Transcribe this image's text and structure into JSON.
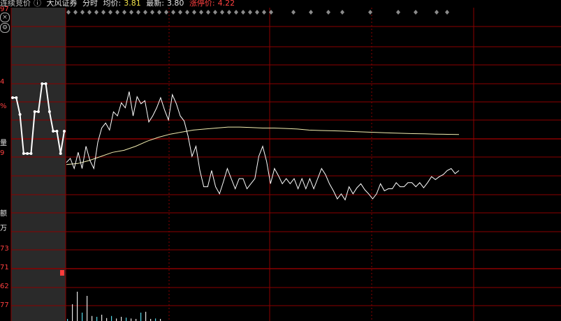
{
  "header": {
    "mode_label": "连续竞价",
    "info_icon": "info-icon",
    "stock_name": "大风证券",
    "view_label": "分时",
    "avg_label": "均价:",
    "avg_value": "3.81",
    "latest_label": "最新:",
    "latest_value": "3.80",
    "limit_label": "涨停价:",
    "limit_value": "4.22"
  },
  "left_axis": {
    "top_value": "97",
    "label_1": "4",
    "label_2": "%",
    "label_3": "量",
    "label_4": "9",
    "label_5": "额",
    "label_6": "万",
    "label_7": "73",
    "label_8": "71",
    "label_9": "62",
    "label_10": "77"
  },
  "left_icons": [
    "close-icon",
    "settings-icon"
  ],
  "colors": {
    "background": "#000000",
    "grid": "#8b0000",
    "price_line": "#ffffff",
    "avg_line": "#f2edb0",
    "auction_panel": "#2a2a2a",
    "volume_cyan": "#55d7e8",
    "volume_red": "#ff3b3b"
  },
  "chart_data": {
    "type": "line",
    "series": [
      {
        "values": [
          0.16,
          0.2,
          0.1,
          0.26,
          0.1,
          0.32,
          0.18,
          0.1,
          0.36,
          0.5,
          0.55,
          0.48,
          0.66,
          0.62,
          0.75,
          0.7,
          0.86,
          0.62,
          0.81,
          0.74,
          0.77,
          0.56,
          0.62,
          0.7,
          0.8,
          0.68,
          0.58,
          0.83,
          0.74,
          0.62,
          0.57,
          0.42,
          0.22,
          0.32,
          0.08,
          -0.08,
          -0.08,
          0.08,
          -0.08,
          -0.15,
          -0.03,
          0.1,
          0.0,
          -0.1,
          0.0,
          0.0,
          -0.1,
          -0.05,
          0.0,
          0.22,
          0.32,
          0.17,
          -0.05,
          0.1,
          0.03,
          -0.05,
          0.0,
          -0.05,
          0.0,
          -0.1,
          0.0,
          -0.1,
          0.0,
          -0.1,
          0.0,
          0.1,
          0.04,
          -0.05,
          -0.12,
          -0.2,
          -0.15,
          -0.21,
          -0.08,
          -0.15,
          -0.09,
          -0.05,
          -0.11,
          -0.15,
          -0.2,
          -0.15,
          -0.05,
          -0.12,
          -0.1,
          -0.1,
          -0.04,
          -0.08,
          -0.08,
          -0.04,
          -0.04,
          -0.08,
          -0.04,
          -0.09,
          -0.04,
          0.02,
          -0.01,
          0.02,
          0.04,
          0.08,
          0.1,
          0.05,
          0.08
        ]
      },
      {
        "values": [
          0.14,
          0.15,
          0.18,
          0.22,
          0.26,
          0.28,
          0.32,
          0.37,
          0.41,
          0.44,
          0.46,
          0.48,
          0.49,
          0.5,
          0.51,
          0.51,
          0.505,
          0.5,
          0.5,
          0.496,
          0.49,
          0.48,
          0.476,
          0.473,
          0.47,
          0.465,
          0.46,
          0.456,
          0.452,
          0.448,
          0.445,
          0.443,
          0.44,
          0.438,
          0.436
        ]
      }
    ],
    "grid": true
  },
  "volume": {
    "values": [
      0.05,
      0.4,
      0.7,
      0.2,
      0.6,
      0.12,
      0.1,
      0.15,
      0.07,
      0.12,
      0.06,
      0.1,
      0.08,
      0.06,
      0.05,
      0.2,
      0.22,
      0.05,
      0.06,
      0.05
    ]
  },
  "auction_trace": {
    "values": [
      0.8,
      0.8,
      0.74,
      0.6,
      0.6,
      0.6,
      0.75,
      0.75,
      0.85,
      0.85,
      0.75,
      0.68,
      0.68,
      0.6,
      0.68
    ]
  },
  "top_diamonds": {
    "count": 39
  }
}
